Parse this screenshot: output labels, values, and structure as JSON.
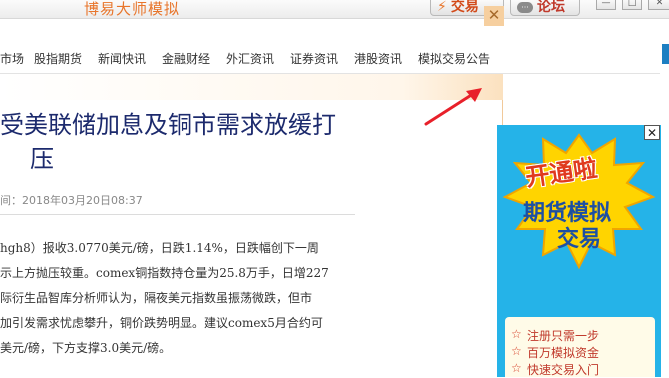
{
  "titlebar": {
    "app_title": "博易大师模拟",
    "trade_label": "交易",
    "trade_icon": "lightning-icon",
    "forum_label": "论坛",
    "forum_icon": "chat-bubble-icon"
  },
  "nav": {
    "items": [
      "市场",
      "股指期货",
      "新闻快讯",
      "金融财经",
      "外汇资讯",
      "证券资讯",
      "港股资讯",
      "模拟交易公告"
    ]
  },
  "article": {
    "headline_line1": "受美联储加息及铜市需求放缓打",
    "headline_line2": "压",
    "meta": "间：2018年03月20日08:37",
    "body_lines": [
      "hgh8）报收3.0770美元/磅，日跌1.14%，日跌幅创下一周",
      "示上方抛压较重。comex铜指数持仓量为25.8万手，日增227",
      "际衍生品智库分析师认为，隔夜美元指数虽振荡微跌，但市",
      "加引发需求忧虑攀升，铜价跌势明显。建议comex5月合约可",
      "美元/磅，下方支撑3.0美元/磅。"
    ]
  },
  "ad": {
    "headline": "开通啦",
    "subtitle_line1": "期货模拟",
    "subtitle_line2": "交易",
    "items": [
      "注册只需一步",
      "百万模拟资金",
      "快速交易入门"
    ],
    "colors": {
      "background": "#25b3e8",
      "burst": "#ffd400",
      "headline": "#e03a1e"
    }
  },
  "colors": {
    "accent_orange": "#e8752b",
    "headline_navy": "#1c2a6d",
    "arrow_red": "#e8202a"
  }
}
